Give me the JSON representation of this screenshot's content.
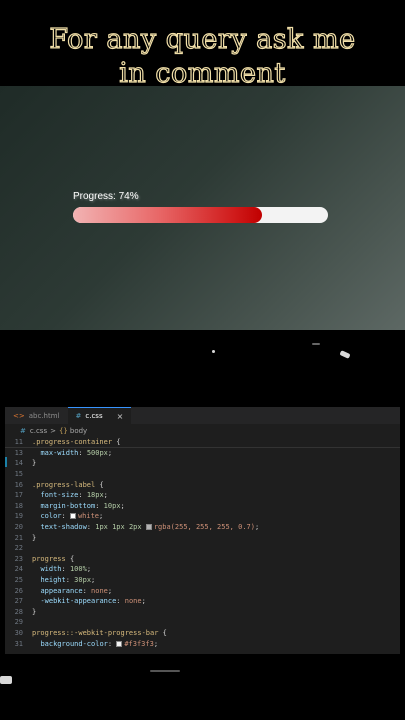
{
  "caption": {
    "line1": "For any query ask me",
    "line2": "in comment"
  },
  "preview": {
    "label": "Progress: 74%",
    "progress_value": 0.74,
    "fill_color": "#d01c1c",
    "track_color": "#f3f3f3"
  },
  "editor": {
    "tabs": [
      {
        "icon": "html-icon",
        "glyph": "<>",
        "label": "abc.html"
      },
      {
        "icon": "css-icon",
        "glyph": "#",
        "label": "c.css",
        "close": "×"
      }
    ],
    "breadcrumb": {
      "file": "c.css",
      "sep": ">",
      "node": "body",
      "node_glyph": "{}"
    },
    "lines": [
      {
        "n": "11",
        "sticky": true,
        "tokens": [
          {
            "c": "sel",
            "t": ".progress-container "
          },
          {
            "c": "txt",
            "t": "{"
          }
        ]
      },
      {
        "n": "13",
        "tokens": [
          {
            "c": "txt",
            "t": "  "
          },
          {
            "c": "prop",
            "t": "max-width"
          },
          {
            "c": "txt",
            "t": ": "
          },
          {
            "c": "num",
            "t": "500px"
          },
          {
            "c": "txt",
            "t": ";"
          }
        ]
      },
      {
        "n": "14",
        "tokens": [
          {
            "c": "txt",
            "t": "}"
          }
        ]
      },
      {
        "n": "15",
        "tokens": []
      },
      {
        "n": "16",
        "tokens": [
          {
            "c": "sel",
            "t": ".progress-label "
          },
          {
            "c": "txt",
            "t": "{"
          }
        ]
      },
      {
        "n": "17",
        "tokens": [
          {
            "c": "txt",
            "t": "  "
          },
          {
            "c": "prop",
            "t": "font-size"
          },
          {
            "c": "txt",
            "t": ": "
          },
          {
            "c": "num",
            "t": "18px"
          },
          {
            "c": "txt",
            "t": ";"
          }
        ]
      },
      {
        "n": "18",
        "tokens": [
          {
            "c": "txt",
            "t": "  "
          },
          {
            "c": "prop",
            "t": "margin-bottom"
          },
          {
            "c": "txt",
            "t": ": "
          },
          {
            "c": "num",
            "t": "10px"
          },
          {
            "c": "txt",
            "t": ";"
          }
        ]
      },
      {
        "n": "19",
        "tokens": [
          {
            "c": "txt",
            "t": "  "
          },
          {
            "c": "prop",
            "t": "color"
          },
          {
            "c": "txt",
            "t": ": "
          },
          {
            "c": "swatch",
            "t": "#ffffff"
          },
          {
            "c": "val",
            "t": "white"
          },
          {
            "c": "txt",
            "t": ";"
          }
        ]
      },
      {
        "n": "20",
        "tokens": [
          {
            "c": "txt",
            "t": "  "
          },
          {
            "c": "prop",
            "t": "text-shadow"
          },
          {
            "c": "txt",
            "t": ": "
          },
          {
            "c": "num",
            "t": "1px 1px 2px "
          },
          {
            "c": "swatch",
            "t": "#b3b3b3"
          },
          {
            "c": "val",
            "t": "rgba(255, 255, 255, 0.7)"
          },
          {
            "c": "txt",
            "t": ";"
          }
        ]
      },
      {
        "n": "21",
        "tokens": [
          {
            "c": "txt",
            "t": "}"
          }
        ]
      },
      {
        "n": "22",
        "tokens": []
      },
      {
        "n": "23",
        "tokens": [
          {
            "c": "sel",
            "t": "progress "
          },
          {
            "c": "txt",
            "t": "{"
          }
        ]
      },
      {
        "n": "24",
        "tokens": [
          {
            "c": "txt",
            "t": "  "
          },
          {
            "c": "prop",
            "t": "width"
          },
          {
            "c": "txt",
            "t": ": "
          },
          {
            "c": "num",
            "t": "100%"
          },
          {
            "c": "txt",
            "t": ";"
          }
        ]
      },
      {
        "n": "25",
        "tokens": [
          {
            "c": "txt",
            "t": "  "
          },
          {
            "c": "prop",
            "t": "height"
          },
          {
            "c": "txt",
            "t": ": "
          },
          {
            "c": "num",
            "t": "30px"
          },
          {
            "c": "txt",
            "t": ";"
          }
        ]
      },
      {
        "n": "26",
        "tokens": [
          {
            "c": "txt",
            "t": "  "
          },
          {
            "c": "prop",
            "t": "appearance"
          },
          {
            "c": "txt",
            "t": ": "
          },
          {
            "c": "val",
            "t": "none"
          },
          {
            "c": "txt",
            "t": ";"
          }
        ]
      },
      {
        "n": "27",
        "tokens": [
          {
            "c": "txt",
            "t": "  "
          },
          {
            "c": "prop",
            "t": "-webkit-appearance"
          },
          {
            "c": "txt",
            "t": ": "
          },
          {
            "c": "val",
            "t": "none"
          },
          {
            "c": "txt",
            "t": ";"
          }
        ]
      },
      {
        "n": "28",
        "tokens": [
          {
            "c": "txt",
            "t": "}"
          }
        ]
      },
      {
        "n": "29",
        "tokens": []
      },
      {
        "n": "30",
        "tokens": [
          {
            "c": "sel",
            "t": "progress::-webkit-progress-bar "
          },
          {
            "c": "txt",
            "t": "{"
          }
        ]
      },
      {
        "n": "31",
        "tokens": [
          {
            "c": "txt",
            "t": "  "
          },
          {
            "c": "prop",
            "t": "background-color"
          },
          {
            "c": "txt",
            "t": ": "
          },
          {
            "c": "swatch",
            "t": "#f3f3f3"
          },
          {
            "c": "val",
            "t": "#f3f3f3"
          },
          {
            "c": "txt",
            "t": ";"
          }
        ]
      }
    ]
  }
}
